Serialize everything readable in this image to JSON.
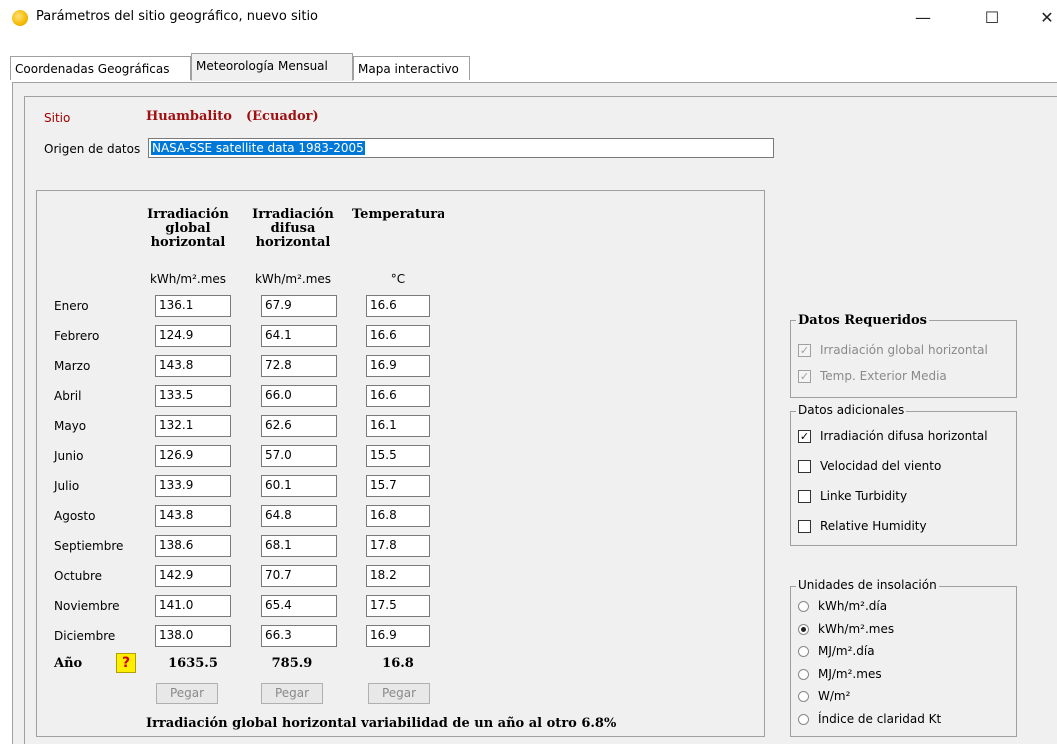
{
  "window": {
    "title": "Parámetros del sitio geográfico, nuevo sitio",
    "min_glyph": "—",
    "max_glyph": "☐",
    "close_glyph": "✕"
  },
  "tabs": [
    {
      "label": "Coordenadas Geográficas",
      "active": false
    },
    {
      "label": "Meteorología Mensual",
      "active": true
    },
    {
      "label": "Mapa interactivo",
      "active": false
    }
  ],
  "site": {
    "label": "Sitio",
    "name": "Huambalito",
    "country": "(Ecuador)"
  },
  "origin": {
    "label": "Origen de datos",
    "value": "NASA-SSE satellite data 1983-2005"
  },
  "table": {
    "columns": [
      {
        "title": "Irradiación global horizontal",
        "t1": "Irradiación",
        "t2": "global",
        "t3": "horizontal",
        "unit": "kWh/m².mes"
      },
      {
        "title": "Irradiación difusa horizontal",
        "t1": "Irradiación",
        "t2": "difusa",
        "t3": "horizontal",
        "unit": "kWh/m².mes"
      },
      {
        "title": "Temperatura",
        "t1": "Temperatura",
        "unit": "°C"
      }
    ],
    "rows": [
      {
        "month": "Enero",
        "global": "136.1",
        "diffuse": "67.9",
        "temp": "16.6"
      },
      {
        "month": "Febrero",
        "global": "124.9",
        "diffuse": "64.1",
        "temp": "16.6"
      },
      {
        "month": "Marzo",
        "global": "143.8",
        "diffuse": "72.8",
        "temp": "16.9"
      },
      {
        "month": "Abril",
        "global": "133.5",
        "diffuse": "66.0",
        "temp": "16.6"
      },
      {
        "month": "Mayo",
        "global": "132.1",
        "diffuse": "62.6",
        "temp": "16.1"
      },
      {
        "month": "Junio",
        "global": "126.9",
        "diffuse": "57.0",
        "temp": "15.5"
      },
      {
        "month": "Julio",
        "global": "133.9",
        "diffuse": "60.1",
        "temp": "15.7"
      },
      {
        "month": "Agosto",
        "global": "143.8",
        "diffuse": "64.8",
        "temp": "16.8"
      },
      {
        "month": "Septiembre",
        "global": "138.6",
        "diffuse": "68.1",
        "temp": "17.8"
      },
      {
        "month": "Octubre",
        "global": "142.9",
        "diffuse": "70.7",
        "temp": "18.2"
      },
      {
        "month": "Noviembre",
        "global": "141.0",
        "diffuse": "65.4",
        "temp": "17.5"
      },
      {
        "month": "Diciembre",
        "global": "138.0",
        "diffuse": "66.3",
        "temp": "16.9"
      }
    ],
    "year": {
      "label": "Año",
      "help": "?",
      "global": "1635.5",
      "diffuse": "785.9",
      "temp": "16.8"
    },
    "paste_label": "Pegar",
    "variability": "Irradiación global horizontal variabilidad de un año al otro  6.8%"
  },
  "required": {
    "legend": "Datos Requeridos",
    "items": [
      {
        "label": "Irradiación global horizontal",
        "checked": true,
        "enabled": false
      },
      {
        "label": "Temp. Exterior Media",
        "checked": true,
        "enabled": false
      }
    ]
  },
  "additional": {
    "legend": "Datos adicionales",
    "items": [
      {
        "label": "Irradiación difusa horizontal",
        "checked": true
      },
      {
        "label": "Velocidad del viento",
        "checked": false
      },
      {
        "label": "Linke Turbidity",
        "checked": false
      },
      {
        "label": "Relative Humidity",
        "checked": false
      }
    ]
  },
  "units": {
    "legend": "Unidades de insolación",
    "options": [
      {
        "label": "kWh/m².día",
        "selected": false
      },
      {
        "label": "kWh/m².mes",
        "selected": true
      },
      {
        "label": "MJ/m².día",
        "selected": false
      },
      {
        "label": "MJ/m².mes",
        "selected": false
      },
      {
        "label": "W/m²",
        "selected": false
      },
      {
        "label": "Índice de claridad Kt",
        "selected": false
      }
    ]
  },
  "check_glyph": "✓"
}
